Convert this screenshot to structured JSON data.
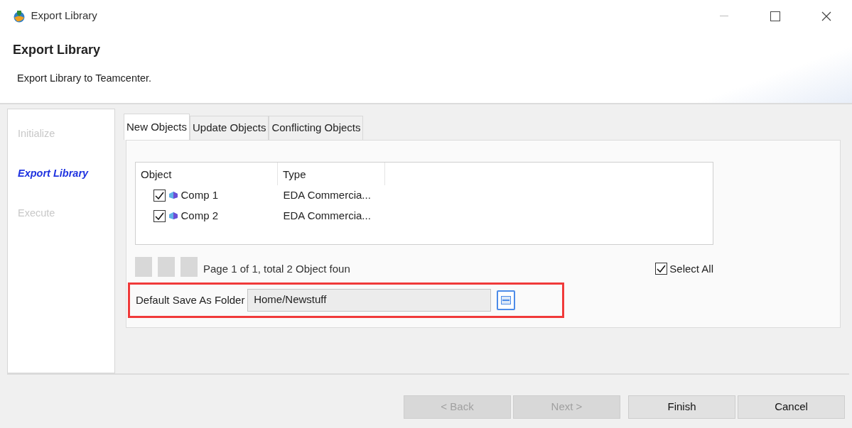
{
  "window": {
    "title": "Export Library"
  },
  "header": {
    "title": "Export Library",
    "subtitle": "Export Library to Teamcenter."
  },
  "steps": [
    {
      "label": "Initialize",
      "selected": false
    },
    {
      "label": "Export Library",
      "selected": true
    },
    {
      "label": "Execute",
      "selected": false
    }
  ],
  "tabs": [
    {
      "label": "New Objects",
      "selected": true
    },
    {
      "label": "Update Objects",
      "selected": false
    },
    {
      "label": "Conflicting Objects",
      "selected": false
    }
  ],
  "table": {
    "columns": [
      "Object",
      "Type"
    ],
    "rows": [
      {
        "name": "Comp 1",
        "type": "EDA Commercia...",
        "checked": true
      },
      {
        "name": "Comp 2",
        "type": "EDA Commercia...",
        "checked": true
      }
    ]
  },
  "pagination": {
    "text": "Page 1 of 1, total 2 Object foun",
    "disabled": true
  },
  "select_all": {
    "label": "Select All",
    "checked": true
  },
  "save_folder": {
    "label": "Default Save As Folder",
    "value": "Home/Newstuff",
    "highlighted": true
  },
  "buttons": [
    {
      "label": "< Back",
      "disabled": true
    },
    {
      "label": "Next >",
      "disabled": true
    },
    {
      "label": "Finish",
      "disabled": false
    },
    {
      "label": "Cancel",
      "disabled": false
    }
  ]
}
